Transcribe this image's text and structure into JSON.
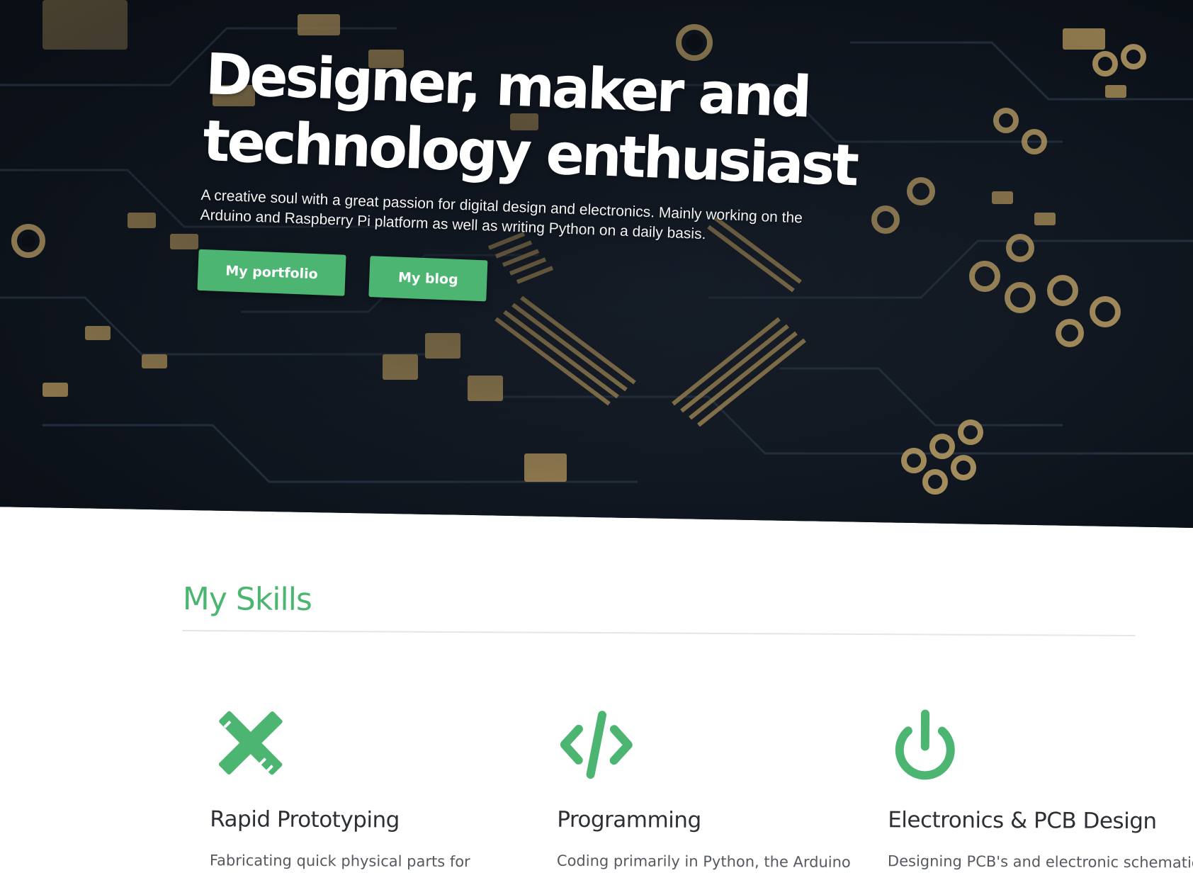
{
  "hero": {
    "title_line1": "Designer, maker and",
    "title_line2": "technology enthusiast",
    "subtitle": "A creative soul with a great passion for digital design and electronics. Mainly working on the Arduino and Raspberry Pi platform as well as writing Python on a daily basis.",
    "buttons": {
      "portfolio": "My portfolio",
      "blog": "My blog"
    },
    "background": "circuit-board-photo"
  },
  "skills": {
    "heading": "My Skills",
    "items": [
      {
        "icon": "pencil-ruler-icon",
        "title": "Rapid Prototyping",
        "description": "Fabricating quick physical parts for"
      },
      {
        "icon": "code-icon",
        "title": "Programming",
        "description": "Coding primarily in Python, the Arduino"
      },
      {
        "icon": "power-icon",
        "title": "Electronics & PCB Design",
        "description": "Designing PCB's and electronic schematics"
      }
    ]
  },
  "colors": {
    "accent": "#4cb571",
    "hero_bg": "#0e141c",
    "pcb_gold": "#b89a5e",
    "text_dark": "#2c2f33"
  }
}
